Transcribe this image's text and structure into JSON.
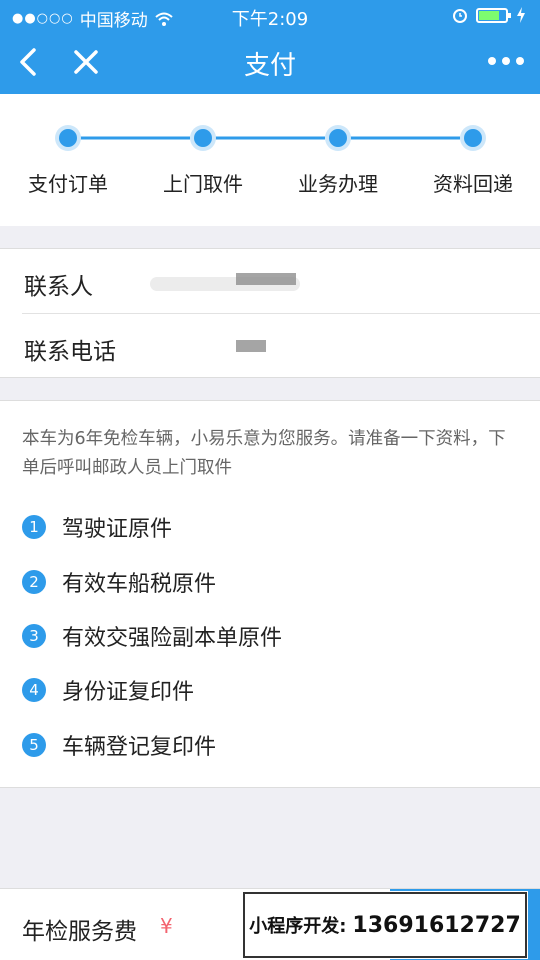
{
  "status_bar": {
    "carrier": "中国移动",
    "time": "下午2:09"
  },
  "nav": {
    "title": "支付",
    "icons": [
      "back-chevron-icon",
      "close-icon",
      "more-icon"
    ]
  },
  "steps": [
    "支付订单",
    "上门取件",
    "业务办理",
    "资料回递"
  ],
  "form": {
    "contact_label": "联系人",
    "phone_label": "联系电话"
  },
  "info": {
    "notice": "本车为6年免检车辆，小易乐意为您服务。请准备一下资料，下单后呼叫邮政人员上门取件",
    "items": [
      {
        "num": "1",
        "text": "驾驶证原件"
      },
      {
        "num": "2",
        "text": "有效车船税原件"
      },
      {
        "num": "3",
        "text": "有效交强险副本单原件"
      },
      {
        "num": "4",
        "text": "身份证复印件"
      },
      {
        "num": "5",
        "text": "车辆登记复印件"
      }
    ]
  },
  "bottom": {
    "fee_label": "年检服务费",
    "fee_amount": "¥"
  },
  "overlay": {
    "label": "小程序开发:",
    "phone": "13691612727"
  },
  "colors": {
    "accent": "#2e9bea"
  }
}
